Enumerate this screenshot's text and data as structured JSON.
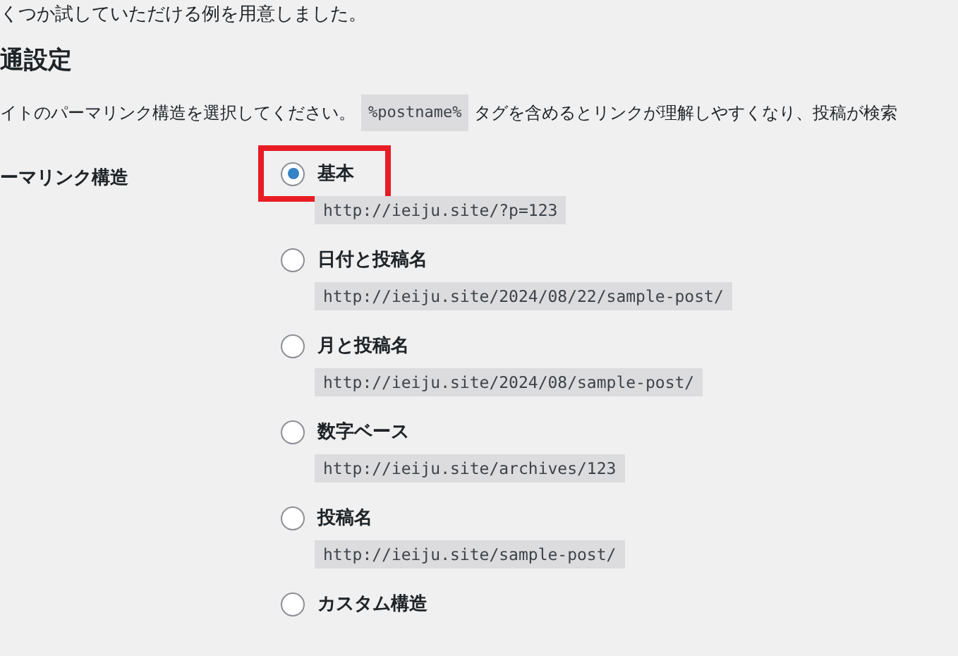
{
  "intro": "くつか試していただける例を用意しました。",
  "section_title": "通設定",
  "description": {
    "before": "イトのパーマリンク構造を選択してください。",
    "code": "%postname%",
    "after": "タグを含めるとリンクが理解しやすくなり、投稿が検索"
  },
  "field_label": "ーマリンク構造",
  "options": [
    {
      "label": "基本",
      "example": "http://ieiju.site/?p=123",
      "selected": true,
      "highlighted": true
    },
    {
      "label": "日付と投稿名",
      "example": "http://ieiju.site/2024/08/22/sample-post/",
      "selected": false,
      "highlighted": false
    },
    {
      "label": "月と投稿名",
      "example": "http://ieiju.site/2024/08/sample-post/",
      "selected": false,
      "highlighted": false
    },
    {
      "label": "数字ベース",
      "example": "http://ieiju.site/archives/123",
      "selected": false,
      "highlighted": false
    },
    {
      "label": "投稿名",
      "example": "http://ieiju.site/sample-post/",
      "selected": false,
      "highlighted": false
    },
    {
      "label": "カスタム構造",
      "selected": false,
      "highlighted": false
    }
  ]
}
